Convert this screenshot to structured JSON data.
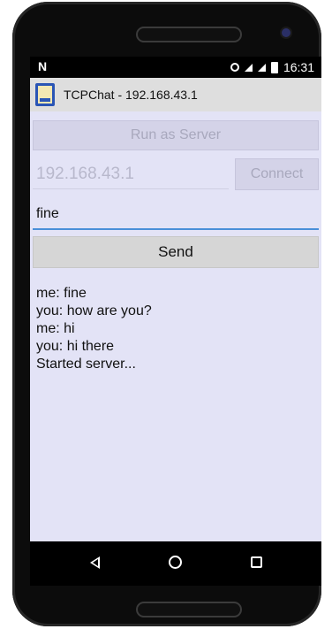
{
  "statusbar": {
    "time": "16:31",
    "notification_icon": "n-icon",
    "icons": [
      "cast-icon",
      "signal-icon",
      "signal-icon",
      "battery-icon"
    ]
  },
  "app": {
    "title": "TCPChat - 192.168.43.1",
    "icon": "app-icon"
  },
  "controls": {
    "run_server_label": "Run as Server",
    "ip_value": "192.168.43.1",
    "connect_label": "Connect",
    "message_value": "fine",
    "send_label": "Send"
  },
  "log": [
    "me: fine",
    "you: how are you?",
    "me: hi",
    "you: hi there",
    "Started server..."
  ],
  "navbar": {
    "back": "back-icon",
    "home": "home-icon",
    "recents": "recents-icon"
  },
  "colors": {
    "content_bg": "#e3e3f6",
    "titlebar_bg": "#dedede",
    "accent": "#4a8fd8"
  }
}
